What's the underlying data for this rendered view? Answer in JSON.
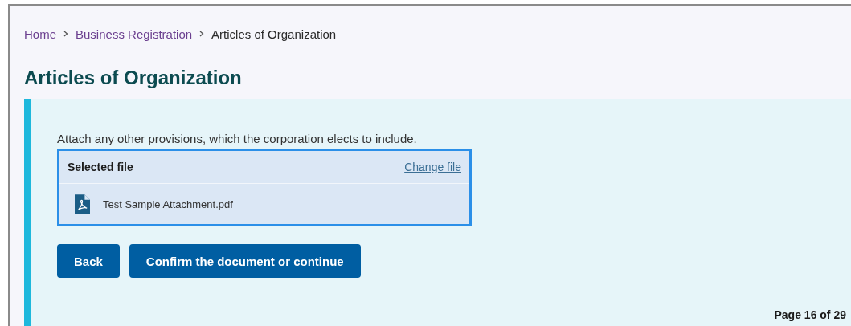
{
  "breadcrumb": [
    {
      "label": "Home",
      "kind": "link"
    },
    {
      "label": "Business Registration",
      "kind": "link"
    },
    {
      "label": "Articles of Organization",
      "kind": "current"
    }
  ],
  "title": "Articles of Organization",
  "prompt": "Attach any other provisions, which the corporation elects to include.",
  "file_box": {
    "heading": "Selected file",
    "change_link": "Change file",
    "file_name": "Test Sample Attachment.pdf"
  },
  "buttons": [
    {
      "label": "Back"
    },
    {
      "label": "Confirm the document or continue"
    }
  ],
  "page_indicator": "Page 16 of 29"
}
